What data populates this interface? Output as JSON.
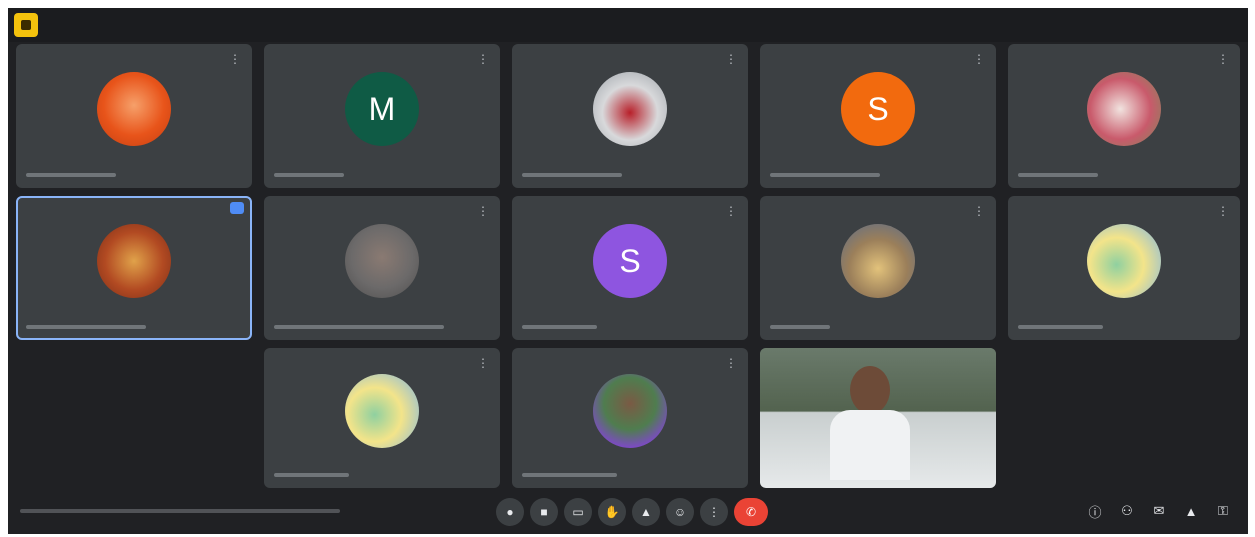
{
  "window": {
    "app_icon": "meet-logo-icon"
  },
  "participants": [
    {
      "name": "",
      "avatar": {
        "type": "picture",
        "color": "#e8541a",
        "letter": ""
      }
    },
    {
      "name": "",
      "avatar": {
        "type": "letter",
        "color": "#0f5b45",
        "letter": "M"
      }
    },
    {
      "name": "",
      "avatar": {
        "type": "picture",
        "color": "#c8c9cb",
        "letter": ""
      }
    },
    {
      "name": "",
      "avatar": {
        "type": "letter",
        "color": "#f26a0e",
        "letter": "S"
      }
    },
    {
      "name": "",
      "avatar": {
        "type": "picture",
        "color": "#d9b6bd",
        "letter": ""
      }
    },
    {
      "name": "",
      "avatar": {
        "type": "picture",
        "color": "#a84b27",
        "letter": ""
      },
      "active_speaker": true
    },
    {
      "name": "",
      "avatar": {
        "type": "picture",
        "color": "#6c6a6a",
        "letter": ""
      }
    },
    {
      "name": "",
      "avatar": {
        "type": "letter",
        "color": "#8e55e0",
        "letter": "S"
      }
    },
    {
      "name": "",
      "avatar": {
        "type": "picture",
        "color": "#b8a27a",
        "letter": ""
      }
    },
    {
      "name": "",
      "avatar": {
        "type": "picture",
        "color": "#e9d98d",
        "letter": ""
      }
    },
    {
      "name": "",
      "avatar": {
        "type": "picture",
        "color": "#e9d98d",
        "letter": ""
      }
    },
    {
      "name": "",
      "avatar": {
        "type": "picture",
        "color": "#5b8d5a",
        "letter": ""
      }
    },
    {
      "name": "",
      "avatar": {
        "type": "video",
        "color": "#4b5a4c",
        "letter": ""
      }
    }
  ],
  "bottom_bar": {
    "time": "",
    "meeting_code": "",
    "controls": [
      {
        "name": "mic-icon"
      },
      {
        "name": "camera-icon"
      },
      {
        "name": "captions-icon"
      },
      {
        "name": "hand-icon"
      },
      {
        "name": "present-icon"
      },
      {
        "name": "reactions-icon"
      },
      {
        "name": "more-options-icon"
      },
      {
        "name": "leave-call-icon"
      }
    ],
    "right_controls": [
      {
        "name": "info-icon"
      },
      {
        "name": "people-icon",
        "count": ""
      },
      {
        "name": "chat-icon"
      },
      {
        "name": "activities-icon"
      },
      {
        "name": "lock-icon"
      }
    ]
  },
  "colors": {
    "background": "#202124",
    "tile": "#3c4043",
    "accent": "#8ab4f8",
    "leave": "#ea4335"
  }
}
